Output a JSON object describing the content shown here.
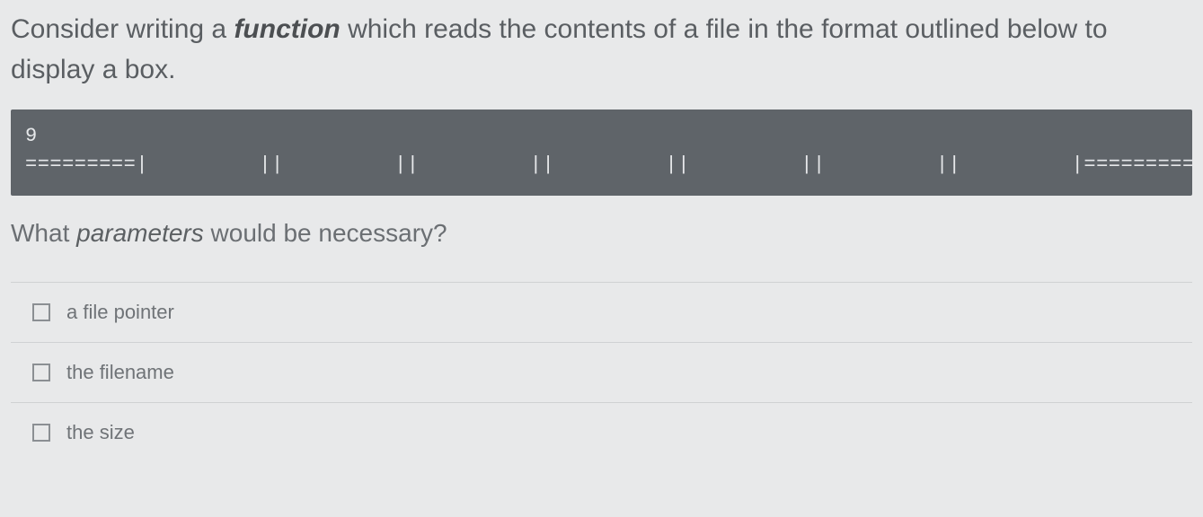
{
  "question": {
    "pre": "Consider writing a ",
    "em": "function",
    "post": " which reads the contents of a file in the format outlined below to display a box."
  },
  "code": {
    "line1": "9",
    "line2": "=========|         ||         ||         ||         ||         ||         ||         |========="
  },
  "sub_question": {
    "pre": "What ",
    "em": "parameters",
    "post": " would be necessary?"
  },
  "options": [
    {
      "label": "a file pointer",
      "checked": false
    },
    {
      "label": "the filename",
      "checked": false
    },
    {
      "label": "the size",
      "checked": false
    }
  ]
}
